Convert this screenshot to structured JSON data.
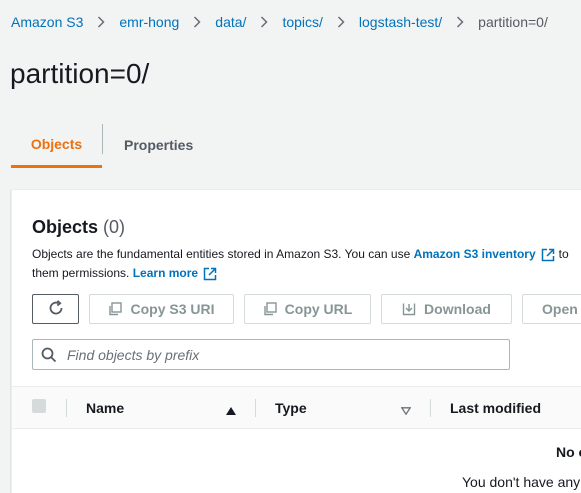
{
  "breadcrumb": {
    "items": [
      "Amazon S3",
      "emr-hong",
      "data/",
      "topics/",
      "logstash-test/"
    ],
    "current": "partition=0/"
  },
  "page": {
    "title": "partition=0/"
  },
  "tabs": {
    "objects": "Objects",
    "properties": "Properties"
  },
  "objects_panel": {
    "title": "Objects",
    "count": "(0)",
    "desc_part1": "Objects are the fundamental entities stored in Amazon S3. You can use",
    "desc_link1": "Amazon S3 inventory",
    "desc_part2": "to",
    "desc_part3": "them permissions.",
    "desc_link2": "Learn more"
  },
  "toolbar": {
    "copy_s3_uri": "Copy S3 URI",
    "copy_url": "Copy URL",
    "download": "Download",
    "open": "Open"
  },
  "search": {
    "placeholder": "Find objects by prefix"
  },
  "table": {
    "columns": {
      "name": "Name",
      "type": "Type",
      "last_modified": "Last modified"
    }
  },
  "empty_state": {
    "title": "No o",
    "text": "You don't have any"
  },
  "colors": {
    "link": "#0073bb",
    "accent": "#ec7211",
    "disabled": "#879596"
  }
}
